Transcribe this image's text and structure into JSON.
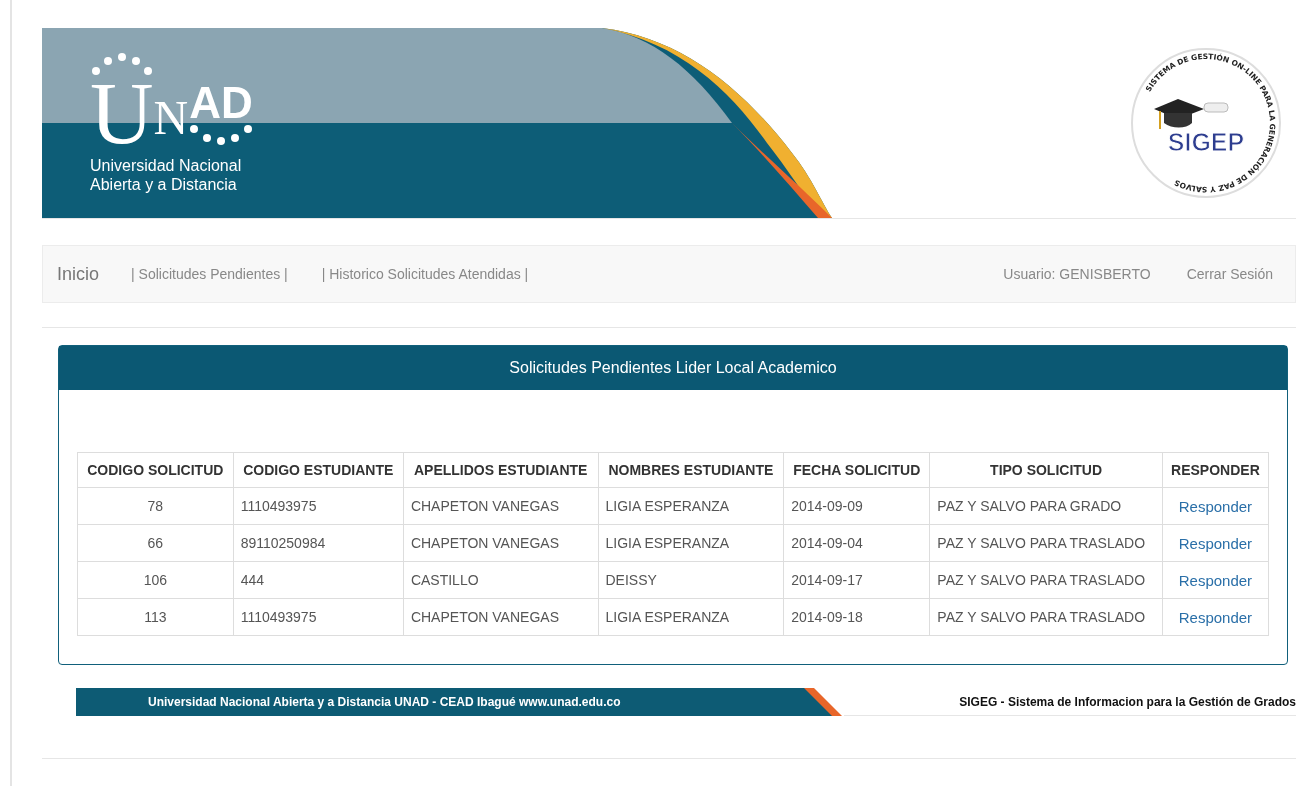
{
  "header": {
    "logo_letters": [
      "U",
      "N",
      "AD"
    ],
    "logo_lines": [
      "Universidad Nacional",
      "Abierta y a Distancia"
    ],
    "seal_ring": "SISTEMA DE GESTIÓN ON-LINE PARA LA GENERACIÓN DE PAZ Y SALVOS",
    "seal_title": "SIGEP"
  },
  "nav": {
    "home": "Inicio",
    "links": [
      "| Solicitudes Pendientes |",
      "| Historico Solicitudes Atendidas |"
    ],
    "user": "Usuario: GENISBERTO",
    "logout": "Cerrar Sesión"
  },
  "panel": {
    "title": "Solicitudes Pendientes Lider Local Academico"
  },
  "table": {
    "columns": [
      "CODIGO SOLICITUD",
      "CODIGO ESTUDIANTE",
      "APELLIDOS ESTUDIANTE",
      "NOMBRES ESTUDIANTE",
      "FECHA SOLICITUD",
      "TIPO SOLICITUD",
      "RESPONDER"
    ],
    "rows": [
      {
        "cells": [
          "78",
          "1110493975",
          "CHAPETON VANEGAS",
          "LIGIA ESPERANZA",
          "2014-09-09",
          "PAZ Y SALVO PARA GRADO"
        ],
        "action": "Responder"
      },
      {
        "cells": [
          "66",
          "89110250984",
          "CHAPETON VANEGAS",
          "LIGIA ESPERANZA",
          "2014-09-04",
          "PAZ Y SALVO PARA TRASLADO"
        ],
        "action": "Responder"
      },
      {
        "cells": [
          "106",
          "444",
          "CASTILLO",
          "DEISSY",
          "2014-09-17",
          "PAZ Y SALVO PARA TRASLADO"
        ],
        "action": "Responder"
      },
      {
        "cells": [
          "113",
          "1110493975",
          "CHAPETON VANEGAS",
          "LIGIA ESPERANZA",
          "2014-09-18",
          "PAZ Y SALVO PARA TRASLADO"
        ],
        "action": "Responder"
      }
    ]
  },
  "footer": {
    "left": "Universidad Nacional Abierta y a Distancia UNAD - CEAD Ibagué  www.unad.edu.co",
    "right": "SIGEG - Sistema de Informacion para la Gestión de Grados"
  }
}
